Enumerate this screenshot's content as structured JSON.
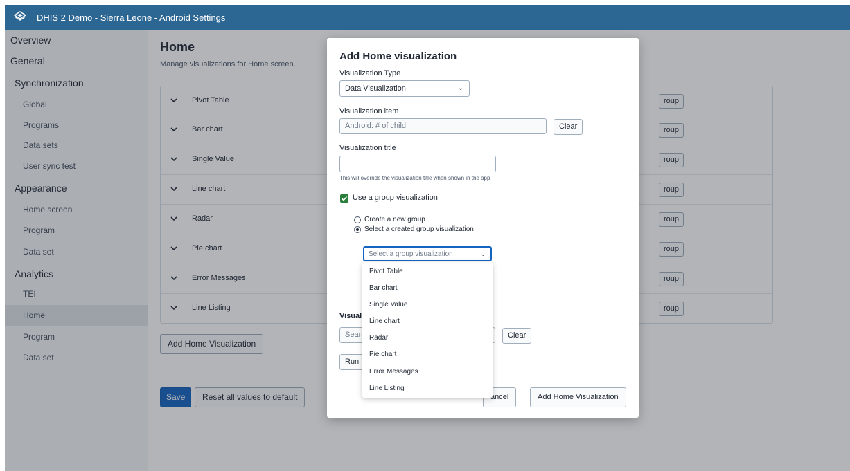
{
  "app": {
    "title": "DHIS 2 Demo - Sierra Leone - Android Settings",
    "logo_icon": "dhis2-logo-icon"
  },
  "sidebar": {
    "items": [
      {
        "label": "Overview",
        "level": 1
      },
      {
        "label": "General",
        "level": 1
      },
      {
        "label": "Synchronization",
        "level": 2
      },
      {
        "label": "Global",
        "level": 3
      },
      {
        "label": "Programs",
        "level": 3
      },
      {
        "label": "Data sets",
        "level": 3
      },
      {
        "label": "User sync test",
        "level": 3
      },
      {
        "label": "Appearance",
        "level": 2
      },
      {
        "label": "Home screen",
        "level": 3
      },
      {
        "label": "Program",
        "level": 3
      },
      {
        "label": "Data set",
        "level": 3
      },
      {
        "label": "Analytics",
        "level": 2
      },
      {
        "label": "TEI",
        "level": 3
      },
      {
        "label": "Home",
        "level": 3,
        "active": true
      },
      {
        "label": "Program",
        "level": 3
      },
      {
        "label": "Data set",
        "level": 3
      }
    ]
  },
  "main": {
    "title": "Home",
    "subtitle": "Manage visualizations for Home screen.",
    "visualizations": [
      "Pivot Table",
      "Bar chart",
      "Single Value",
      "Line chart",
      "Radar",
      "Pie chart",
      "Error Messages",
      "Line Listing"
    ],
    "group_button_label": "roup",
    "add_button": "Add Home Visualization",
    "save_button": "Save",
    "reset_button": "Reset all values to default"
  },
  "modal": {
    "title": "Add Home visualization",
    "type_label": "Visualization Type",
    "type_value": "Data Visualization",
    "item_label": "Visualization item",
    "item_placeholder": "Android: # of child",
    "clear_label": "Clear",
    "title_label": "Visualization title",
    "title_value": "",
    "helper_text": "This will override the visualization title when shown in the app",
    "use_group_label": "Use a group visualization",
    "use_group_checked": true,
    "radio_new_group": "Create a new group",
    "radio_select_group": "Select a created group visualization",
    "group_select_placeholder": "Select a group visualization",
    "partial_visuali": "Visuali",
    "partial_search": "Searc",
    "clear_label_2": "Clear",
    "partial_run": "Run t",
    "cancel_label": "ancel",
    "add_label": "Add Home Visualization"
  },
  "dropdown": {
    "options": [
      "Pivot Table",
      "Bar chart",
      "Single Value",
      "Line chart",
      "Radar",
      "Pie chart",
      "Error Messages",
      "Line Listing"
    ]
  },
  "colors": {
    "header": "#2c6693",
    "primary": "#1565c0",
    "checkbox": "#2a7d3b"
  }
}
